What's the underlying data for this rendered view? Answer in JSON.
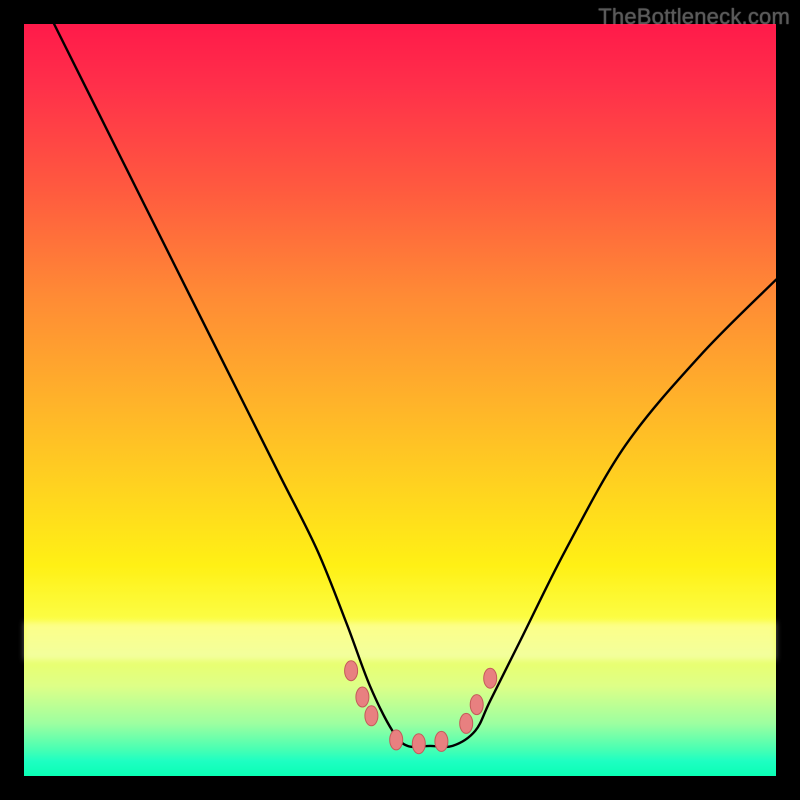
{
  "watermark": "TheBottleneck.com",
  "chart_data": {
    "type": "line",
    "title": "",
    "xlabel": "",
    "ylabel": "",
    "xlim": [
      0,
      100
    ],
    "ylim": [
      0,
      100
    ],
    "legend": false,
    "grid": false,
    "background_gradient": {
      "direction": "vertical",
      "stops": [
        {
          "pos": 0,
          "color": "#ff1a4a"
        },
        {
          "pos": 22,
          "color": "#ff5a3f"
        },
        {
          "pos": 50,
          "color": "#ffb22a"
        },
        {
          "pos": 72,
          "color": "#fff015"
        },
        {
          "pos": 93,
          "color": "#9dffa0"
        },
        {
          "pos": 100,
          "color": "#0affb5"
        }
      ]
    },
    "series": [
      {
        "name": "bottleneck-curve",
        "x": [
          4,
          10,
          16,
          22,
          28,
          34,
          39,
          43,
          46,
          49,
          51,
          54,
          57,
          60,
          62,
          66,
          72,
          80,
          90,
          100
        ],
        "y": [
          100,
          88,
          76,
          64,
          52,
          40,
          30,
          20,
          12,
          6,
          4,
          4,
          4,
          6,
          10,
          18,
          30,
          44,
          56,
          66
        ]
      }
    ],
    "markers": {
      "name": "highlight-points",
      "x": [
        43.5,
        45.0,
        46.2,
        49.5,
        52.5,
        55.5,
        58.8,
        60.2,
        62.0
      ],
      "y": [
        14.0,
        10.5,
        8.0,
        4.8,
        4.3,
        4.6,
        7.0,
        9.5,
        13.0
      ]
    }
  }
}
